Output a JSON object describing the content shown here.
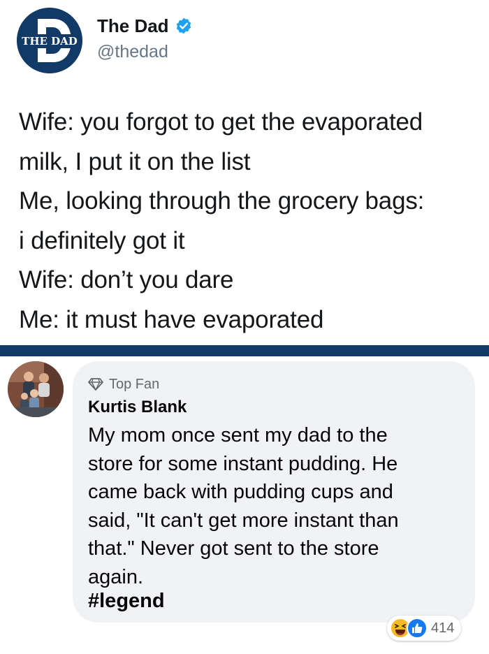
{
  "tweet": {
    "avatar_text": "THE DAD",
    "display_name": "The Dad",
    "verified_icon": "verified-badge-icon",
    "handle": "@thedad",
    "lines": [
      "Wife: you forgot to get the evaporated",
      "milk, I put it on the list",
      "Me, looking through the grocery bags:",
      "i definitely got it",
      "Wife: don’t you dare",
      "Me: it must have evaporated"
    ]
  },
  "colors": {
    "twitter_blue": "#1da1f2",
    "divider_navy": "#123a66",
    "bubble_gray": "#f0f2f5",
    "like_blue": "#1877f2",
    "haha_yellow": "#f7b928"
  },
  "comment": {
    "badge_icon": "diamond-icon",
    "badge_label": "Top Fan",
    "author": "Kurtis Blank",
    "lines": [
      "My mom once sent my dad to the",
      "store for some instant pudding. He",
      "came back with pudding cups and",
      "said, \"It can't get more instant than",
      "that.\" Never got sent to the store",
      "again."
    ],
    "hashtag": "#legend",
    "reactions": {
      "icons": [
        "haha-icon",
        "like-icon"
      ],
      "count": "414"
    }
  }
}
